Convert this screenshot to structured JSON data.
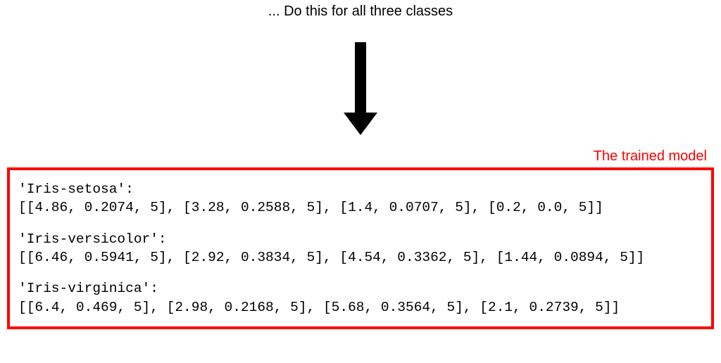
{
  "caption": "... Do this for all three classes",
  "model_label": "The trained model",
  "model": {
    "classes": [
      {
        "name": "'Iris-setosa':",
        "values": "[[4.86, 0.2074, 5], [3.28, 0.2588, 5], [1.4, 0.0707, 5], [0.2, 0.0, 5]]"
      },
      {
        "name": "'Iris-versicolor':",
        "values": "[[6.46, 0.5941, 5], [2.92, 0.3834, 5], [4.54, 0.3362, 5], [1.44, 0.0894, 5]]"
      },
      {
        "name": "'Iris-virginica':",
        "values": "[[6.4, 0.469, 5], [2.98, 0.2168, 5], [5.68, 0.3564, 5], [2.1, 0.2739, 5]]"
      }
    ]
  }
}
